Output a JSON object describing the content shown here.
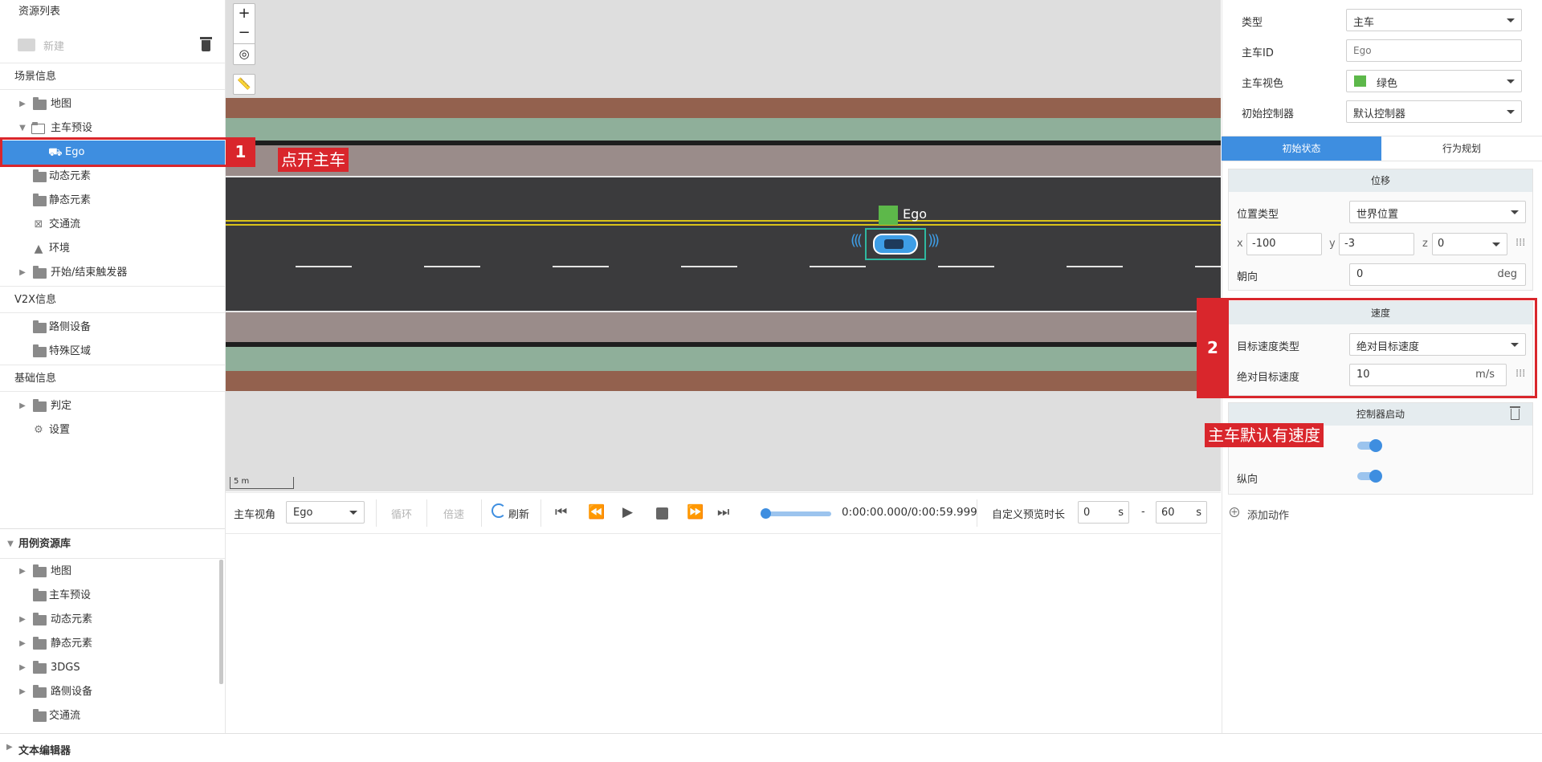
{
  "left_panel": {
    "resource_list_title": "资源列表",
    "new_label": "新建",
    "scene_info_title": "场景信息",
    "scene_items": [
      "地图",
      "主车预设",
      "Ego",
      "动态元素",
      "静态元素",
      "交通流",
      "环境",
      "开始/结束触发器"
    ],
    "v2x_title": "V2X信息",
    "v2x_items": [
      "路侧设备",
      "特殊区域"
    ],
    "basic_title": "基础信息",
    "basic_items": [
      "判定",
      "设置"
    ],
    "case_lib_title": "用例资源库",
    "case_items": [
      "地图",
      "主车预设",
      "动态元素",
      "静态元素",
      "3DGS",
      "路侧设备",
      "交通流"
    ],
    "text_editor_title": "文本编辑器"
  },
  "map": {
    "ego_label": "Ego",
    "scale_label": "5 m",
    "ego_color": "#5db84a",
    "road_color": "#3b3b3d",
    "sidewalk_color": "#9a8c8a",
    "grass_color": "#8faf9a",
    "soil_color": "#93614e",
    "center_line_color": "#d9c21a"
  },
  "playback": {
    "view_label": "主车视角",
    "view_value": "Ego",
    "loop_label": "循环",
    "speed_label": "倍速",
    "refresh_label": "刷新",
    "time_display": "0:00:00.000/0:00:59.999",
    "progress": 0.0,
    "custom_label": "自定义预览时长",
    "start_value": "0",
    "start_unit": "s",
    "range_sep": "-",
    "end_value": "60",
    "end_unit": "s"
  },
  "right_panel": {
    "type_label": "类型",
    "type_value": "主车",
    "ego_id_label": "主车ID",
    "ego_id_placeholder": "Ego",
    "color_label": "主车视色",
    "color_value": "绿色",
    "color_swatch": "#5db84a",
    "controller_label": "初始控制器",
    "controller_value": "默认控制器",
    "tabs": [
      "初始状态",
      "行为规划"
    ],
    "position_card": {
      "title": "位移",
      "pos_type_label": "位置类型",
      "pos_type_value": "世界位置",
      "x_label": "x",
      "x_value": "-100",
      "y_label": "y",
      "y_value": "-3",
      "z_label": "z",
      "z_value": "0",
      "heading_label": "朝向",
      "heading_value": "0",
      "heading_unit": "deg"
    },
    "speed_card": {
      "title": "速度",
      "target_type_label": "目标速度类型",
      "target_type_value": "绝对目标速度",
      "abs_speed_label": "绝对目标速度",
      "abs_speed_value": "10",
      "abs_speed_unit": "m/s"
    },
    "controller_card": {
      "title": "控制器启动",
      "longitudinal_label": "纵向"
    },
    "add_action_label": "添加动作"
  },
  "annotations": {
    "badge1": "1",
    "tag1": "点开主车",
    "badge2": "2",
    "tag2": "主车默认有速度",
    "color": "#d9262c"
  }
}
